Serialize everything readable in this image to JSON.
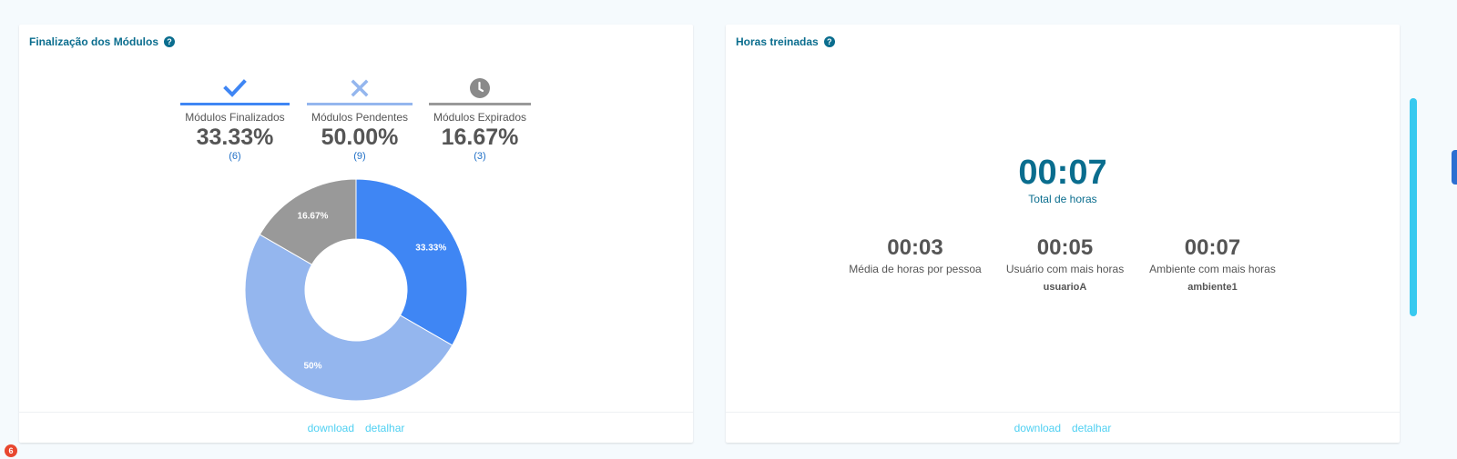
{
  "left_card": {
    "title": "Finalização dos Módulos",
    "help_glyph": "?",
    "stats": [
      {
        "label": "Módulos Finalizados",
        "percent": "33.33%",
        "count": "(6)",
        "icon": "check-icon",
        "color": "#3f86f4"
      },
      {
        "label": "Módulos Pendentes",
        "percent": "50.00%",
        "count": "(9)",
        "icon": "close-icon",
        "color": "#94b6ee"
      },
      {
        "label": "Módulos Expirados",
        "percent": "16.67%",
        "count": "(3)",
        "icon": "clock-icon",
        "color": "#999999"
      }
    ],
    "footer": {
      "download": "download",
      "detail": "detalhar"
    }
  },
  "chart_data": {
    "type": "pie",
    "donut": true,
    "categories": [
      "Módulos Finalizados",
      "Módulos Pendentes",
      "Módulos Expirados"
    ],
    "values": [
      33.33,
      50,
      16.67
    ],
    "slice_labels": [
      "33.33%",
      "50%",
      "16.67%"
    ],
    "colors": [
      "#3f86f4",
      "#94b6ee",
      "#999999"
    ]
  },
  "right_card": {
    "title": "Horas treinadas",
    "help_glyph": "?",
    "total": {
      "value": "00:07",
      "label": "Total de horas"
    },
    "media": {
      "value": "00:03",
      "label": "Média de horas por pessoa"
    },
    "usuario": {
      "value": "00:05",
      "label": "Usuário com mais horas",
      "name": "usuarioA"
    },
    "ambiente": {
      "value": "00:07",
      "label": "Ambiente com mais horas",
      "name": "ambiente1"
    },
    "footer": {
      "download": "download",
      "detail": "detalhar"
    }
  },
  "notification": {
    "count": "6"
  }
}
